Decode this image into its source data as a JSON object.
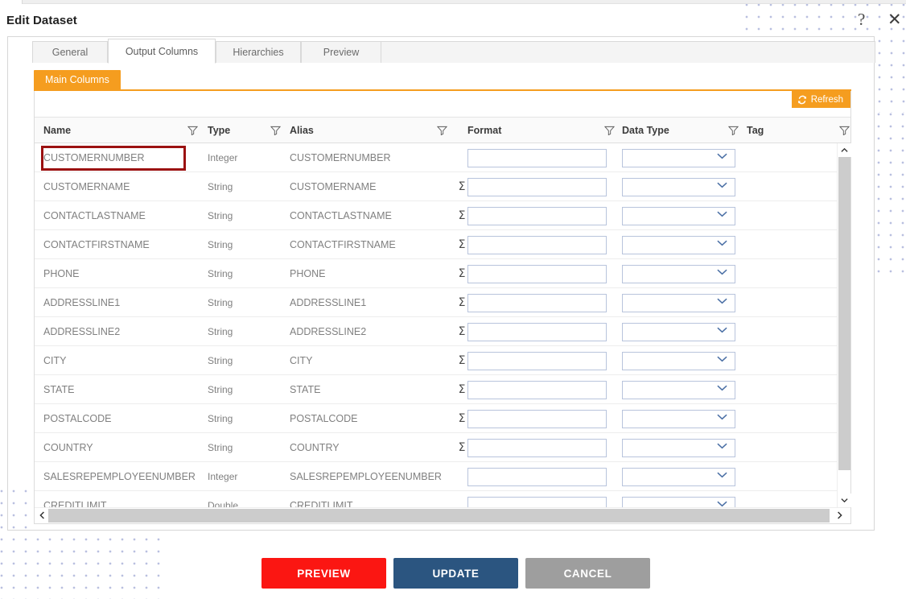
{
  "dialog": {
    "title": "Edit Dataset",
    "help_icon": "question-mark-icon",
    "close_icon": "close-icon"
  },
  "tabs": [
    {
      "label": "General",
      "active": false
    },
    {
      "label": "Output Columns",
      "active": true
    },
    {
      "label": "Hierarchies",
      "active": false
    },
    {
      "label": "Preview",
      "active": false
    }
  ],
  "subtab": {
    "label": "Main Columns"
  },
  "toolbar": {
    "refresh_label": "Refresh",
    "refresh_icon": "refresh-icon"
  },
  "grid": {
    "columns": [
      {
        "label": "Name",
        "filter": true
      },
      {
        "label": "Type",
        "filter": true
      },
      {
        "label": "Alias",
        "filter": true
      },
      {
        "label": "Format",
        "filter": true
      },
      {
        "label": "Data Type",
        "filter": true
      },
      {
        "label": "Tag",
        "filter": true
      }
    ],
    "format_placeholder": "",
    "datatype_placeholder": "",
    "rows": [
      {
        "name": "CUSTOMERNUMBER",
        "type": "Integer",
        "alias": "CUSTOMERNUMBER",
        "sigma": "",
        "format": "",
        "data_type": "",
        "tag": "",
        "selected": true
      },
      {
        "name": "CUSTOMERNAME",
        "type": "String",
        "alias": "CUSTOMERNAME",
        "sigma": "Σ",
        "format": "",
        "data_type": "",
        "tag": "",
        "selected": false
      },
      {
        "name": "CONTACTLASTNAME",
        "type": "String",
        "alias": "CONTACTLASTNAME",
        "sigma": "Σ",
        "format": "",
        "data_type": "",
        "tag": "",
        "selected": false
      },
      {
        "name": "CONTACTFIRSTNAME",
        "type": "String",
        "alias": "CONTACTFIRSTNAME",
        "sigma": "Σ",
        "format": "",
        "data_type": "",
        "tag": "",
        "selected": false
      },
      {
        "name": "PHONE",
        "type": "String",
        "alias": "PHONE",
        "sigma": "Σ",
        "format": "",
        "data_type": "",
        "tag": "",
        "selected": false
      },
      {
        "name": "ADDRESSLINE1",
        "type": "String",
        "alias": "ADDRESSLINE1",
        "sigma": "Σ",
        "format": "",
        "data_type": "",
        "tag": "",
        "selected": false
      },
      {
        "name": "ADDRESSLINE2",
        "type": "String",
        "alias": "ADDRESSLINE2",
        "sigma": "Σ",
        "format": "",
        "data_type": "",
        "tag": "",
        "selected": false
      },
      {
        "name": "CITY",
        "type": "String",
        "alias": "CITY",
        "sigma": "Σ",
        "format": "",
        "data_type": "",
        "tag": "",
        "selected": false
      },
      {
        "name": "STATE",
        "type": "String",
        "alias": "STATE",
        "sigma": "Σ",
        "format": "",
        "data_type": "",
        "tag": "",
        "selected": false
      },
      {
        "name": "POSTALCODE",
        "type": "String",
        "alias": "POSTALCODE",
        "sigma": "Σ",
        "format": "",
        "data_type": "",
        "tag": "",
        "selected": false
      },
      {
        "name": "COUNTRY",
        "type": "String",
        "alias": "COUNTRY",
        "sigma": "Σ",
        "format": "",
        "data_type": "",
        "tag": "",
        "selected": false
      },
      {
        "name": "SALESREPEMPLOYEENUMBER",
        "type": "Integer",
        "alias": "SALESREPEMPLOYEENUMBER",
        "sigma": "",
        "format": "",
        "data_type": "",
        "tag": "",
        "selected": false
      },
      {
        "name": "CREDITLIMIT",
        "type": "Double",
        "alias": "CREDITLIMIT",
        "sigma": "",
        "format": "",
        "data_type": "",
        "tag": "",
        "selected": false
      }
    ]
  },
  "footer": {
    "preview_label": "PREVIEW",
    "update_label": "UPDATE",
    "cancel_label": "CANCEL"
  },
  "colors": {
    "accent_orange": "#f59d1f",
    "preview_red": "#fb1612",
    "update_blue": "#2b5580",
    "cancel_grey": "#9e9e9e",
    "selection_outline": "#9b1111"
  }
}
